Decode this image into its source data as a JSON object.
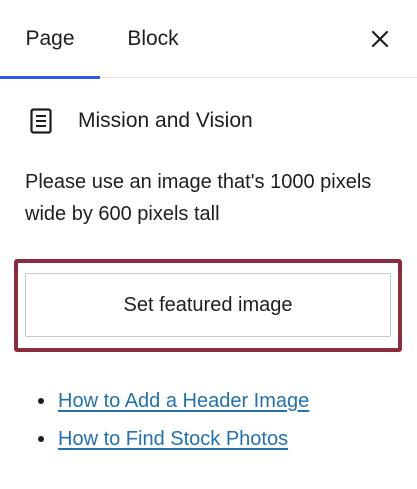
{
  "tabs": [
    {
      "label": "Page",
      "active": true
    },
    {
      "label": "Block",
      "active": false
    }
  ],
  "close_icon": "close-icon",
  "document": {
    "icon": "page-document-icon",
    "title": "Mission and Vision"
  },
  "featured_image": {
    "help_text": "Please use an image that's 1000 pixels wide by 600 pixels tall",
    "button_label": "Set featured image"
  },
  "links": [
    {
      "label": "How to Add a Header Image"
    },
    {
      "label": "How to Find Stock Photos"
    }
  ],
  "colors": {
    "active_tab_underline": "#3858e9",
    "highlight_border": "#8b2b3f",
    "link": "#2271b1",
    "text": "#1e1e1e"
  }
}
